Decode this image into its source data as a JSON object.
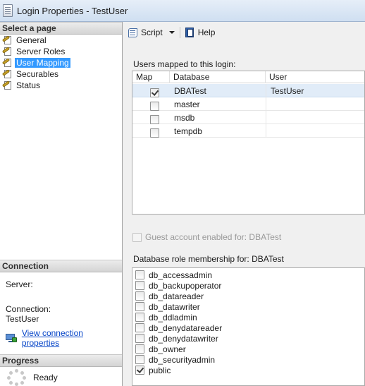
{
  "window": {
    "title": "Login Properties - TestUser"
  },
  "left_pane": {
    "select_page_header": "Select a page",
    "pages": [
      {
        "label": "General",
        "selected": false
      },
      {
        "label": "Server Roles",
        "selected": false
      },
      {
        "label": "User Mapping",
        "selected": true
      },
      {
        "label": "Securables",
        "selected": false
      },
      {
        "label": "Status",
        "selected": false
      }
    ],
    "connection_header": "Connection",
    "server_label": "Server:",
    "connection_label": "Connection:",
    "connection_value": "TestUser",
    "view_connection_link": "View connection properties",
    "progress_header": "Progress",
    "progress_status": "Ready"
  },
  "toolbar": {
    "script_label": "Script",
    "help_label": "Help"
  },
  "users_mapped": {
    "label": "Users mapped to this login:",
    "columns": {
      "map": "Map",
      "database": "Database",
      "user": "User"
    },
    "rows": [
      {
        "database": "DBATest",
        "user": "TestUser",
        "mapped": true,
        "selected": true
      },
      {
        "database": "master",
        "user": "",
        "mapped": false,
        "selected": false
      },
      {
        "database": "msdb",
        "user": "",
        "mapped": false,
        "selected": false
      },
      {
        "database": "tempdb",
        "user": "",
        "mapped": false,
        "selected": false
      }
    ]
  },
  "guest_account": {
    "label": "Guest account enabled for: DBATest",
    "checked": false,
    "enabled": false
  },
  "role_membership": {
    "label": "Database role membership for: DBATest",
    "roles": [
      {
        "name": "db_accessadmin",
        "checked": false
      },
      {
        "name": "db_backupoperator",
        "checked": false
      },
      {
        "name": "db_datareader",
        "checked": false
      },
      {
        "name": "db_datawriter",
        "checked": false
      },
      {
        "name": "db_ddladmin",
        "checked": false
      },
      {
        "name": "db_denydatareader",
        "checked": false
      },
      {
        "name": "db_denydatawriter",
        "checked": false
      },
      {
        "name": "db_owner",
        "checked": false
      },
      {
        "name": "db_securityadmin",
        "checked": false
      },
      {
        "name": "public",
        "checked": true
      }
    ]
  }
}
